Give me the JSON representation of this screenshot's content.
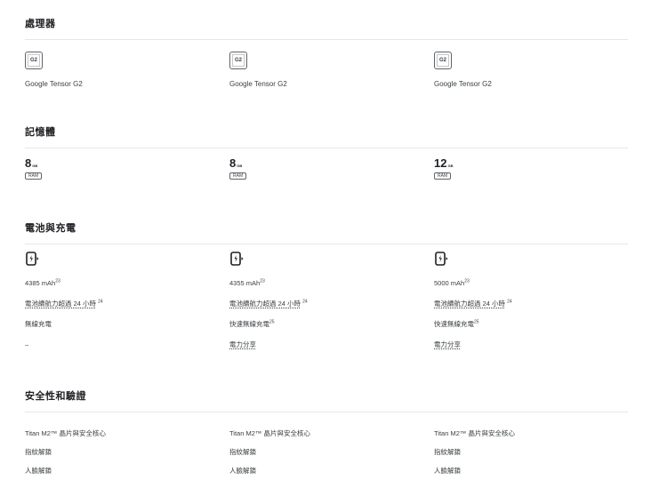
{
  "sections": {
    "processor": {
      "title": "處理器",
      "chip_label": "G2",
      "items": [
        "Google Tensor G2",
        "Google Tensor G2",
        "Google Tensor G2"
      ]
    },
    "memory": {
      "title": "記憶體",
      "items": [
        {
          "value": "8",
          "unit": "GB",
          "badge": "RAM"
        },
        {
          "value": "8",
          "unit": "GB",
          "badge": "RAM"
        },
        {
          "value": "12",
          "unit": "GB",
          "badge": "RAM"
        }
      ]
    },
    "battery": {
      "title": "電池與充電",
      "columns": [
        {
          "capacity": "4385 mAh",
          "capacity_sup": "23",
          "life": "電池續航力超過 24 小時",
          "life_sup": "24",
          "charging": "無線充電",
          "charging_sup": "",
          "share": "–"
        },
        {
          "capacity": "4355 mAh",
          "capacity_sup": "23",
          "life": "電池續航力超過 24 小時",
          "life_sup": "24",
          "charging": "快速無線充電",
          "charging_sup": "25",
          "share": "電力分享"
        },
        {
          "capacity": "5000 mAh",
          "capacity_sup": "23",
          "life": "電池續航力超過 24 小時",
          "life_sup": "24",
          "charging": "快速無線充電",
          "charging_sup": "25",
          "share": "電力分享"
        }
      ]
    },
    "security": {
      "title": "安全性和驗證",
      "columns": [
        {
          "chip": "Titan M2™ 晶片與安全核心",
          "fingerprint": "指紋解鎖",
          "face": "人臉解鎖"
        },
        {
          "chip": "Titan M2™ 晶片與安全核心",
          "fingerprint": "指紋解鎖",
          "face": "人臉解鎖"
        },
        {
          "chip": "Titan M2™ 晶片與安全核心",
          "fingerprint": "指紋解鎖",
          "face": "人臉解鎖"
        }
      ]
    }
  },
  "icons": {
    "chip": "processor-chip-icon",
    "battery": "battery-charging-icon"
  },
  "colors": {
    "text": "#202124",
    "muted": "#3c4043",
    "divider": "#e6e6e6"
  }
}
